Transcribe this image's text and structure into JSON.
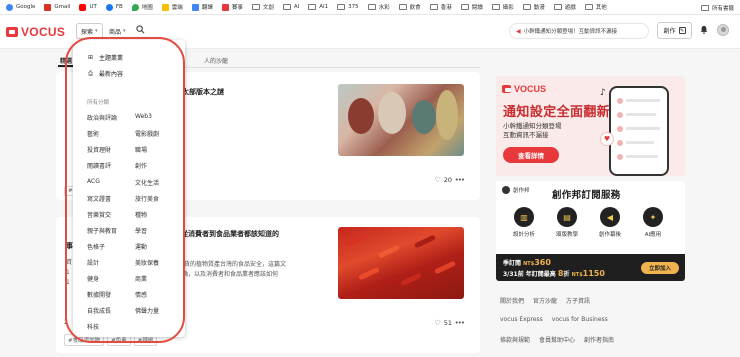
{
  "bookmarks": {
    "items": [
      {
        "label": "Google",
        "icon": "google-icon",
        "color": "#4285f4"
      },
      {
        "label": "Gmail",
        "icon": "gmail-icon",
        "color": "#d93025"
      },
      {
        "label": "UT",
        "icon": "youtube-icon",
        "color": "#ff0000"
      },
      {
        "label": "FB",
        "icon": "facebook-icon",
        "color": "#1877f2"
      },
      {
        "label": "地圖",
        "icon": "maps-icon",
        "color": "#34a853"
      },
      {
        "label": "雲端",
        "icon": "drive-icon",
        "color": "#fbbc04"
      },
      {
        "label": "翻譯",
        "icon": "translate-icon",
        "color": "#4285f4"
      },
      {
        "label": "賽事",
        "icon": "bookmark-icon",
        "color": "#e7383b"
      },
      {
        "label": "文創",
        "icon": "folder-icon"
      },
      {
        "label": "AI",
        "icon": "folder-icon"
      },
      {
        "label": "AI1",
        "icon": "folder-icon"
      },
      {
        "label": "375",
        "icon": "folder-icon"
      },
      {
        "label": "水彩",
        "icon": "folder-icon"
      },
      {
        "label": "飲食",
        "icon": "folder-icon"
      },
      {
        "label": "香港",
        "icon": "folder-icon"
      },
      {
        "label": "閱讀",
        "icon": "folder-icon"
      },
      {
        "label": "攝影",
        "icon": "folder-icon"
      },
      {
        "label": "動漫",
        "icon": "folder-icon"
      },
      {
        "label": "遊戲",
        "icon": "folder-icon"
      },
      {
        "label": "其他",
        "icon": "folder-icon"
      }
    ],
    "all_bookmarks": "所有書籤"
  },
  "header": {
    "logo_text": "VOCUS",
    "explore_label": "探索",
    "products_label": "商品",
    "notice_text": "小幹鐵通知分類登場！互動資訊不漏接",
    "create_label": "創作"
  },
  "tabs": {
    "active_label": "精選",
    "right_label": "人的沙龍"
  },
  "articles": [
    {
      "title_fragment": "太部版本之謎",
      "likes": "20",
      "tags": [
        "#",
        "#"
      ]
    },
    {
      "title_fragment_1": "：從消費者到食品業者都該知道的",
      "title_fragment_2": "事",
      "body_line_1": "出貨的植物質產台灣的食品安全，這篇文",
      "body_line_2": "論，以及消費者和食品業者應該如何",
      "left_numbers": [
        "資",
        "1",
        "1",
        "2"
      ],
      "likes": "51",
      "tags": [
        "#食品添加物",
        "#色素",
        "#辣椒"
      ]
    }
  ],
  "ad1": {
    "logo_text": "VOCUS",
    "title": "通知設定全面翻新",
    "sub1": "小幹鐵通知分類登場",
    "sub2": "互動資訊不漏接",
    "button": "查看詳情"
  },
  "ad2": {
    "brand": "創作邦",
    "title": "創作邦訂閱服務",
    "features": [
      {
        "icon": "chart-icon",
        "label": "設計分析"
      },
      {
        "icon": "book-icon",
        "label": "頒版教學"
      },
      {
        "icon": "megaphone-icon",
        "label": "創作幕後"
      },
      {
        "icon": "sparkle-icon",
        "label": "AI應用"
      }
    ],
    "row1_prefix": "季訂閱",
    "row1_price_prefix": "NT$",
    "row1_price": "360",
    "row2_prefix": "3/31前 年訂閱最高",
    "row2_discount": "8",
    "row2_mid": "折",
    "row2_price_prefix": "NT$",
    "row2_price": "1150",
    "buy_label": "立即加入"
  },
  "footer": {
    "row1": [
      "關於我們",
      "官方沙龍",
      "方子資訊"
    ],
    "row2": [
      "vocus Express",
      "vocus for Business"
    ],
    "row3": [
      "條款與規範",
      "會員幫助中心",
      "創作者指南"
    ]
  },
  "dropdown": {
    "top_items": [
      {
        "icon": "grid-icon",
        "label": "主題業業"
      },
      {
        "icon": "printer-icon",
        "label": "最新內容"
      }
    ],
    "section_title": "所有分類",
    "categories_left": [
      "政治與評論",
      "藝術",
      "投資理財",
      "閱讀書評",
      "ACG",
      "寫文證書",
      "音樂賞交",
      "親子與教育",
      "色格子",
      "設計",
      "健身",
      "數據開發",
      "自我成長",
      "科技"
    ],
    "categories_right": [
      "Web3",
      "電影戲劇",
      "職場",
      "創作",
      "文化生活",
      "旅行美食",
      "種物",
      "學習",
      "運動",
      "美妝保養",
      "商業",
      "情感",
      "佛聲力量"
    ]
  }
}
